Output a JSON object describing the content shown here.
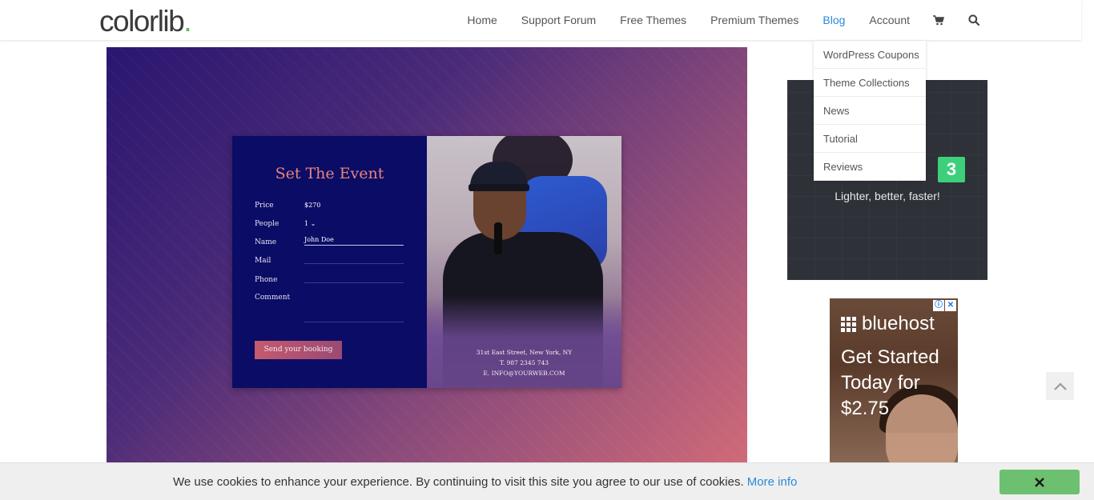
{
  "header": {
    "logo_text": "colorlib",
    "logo_dot": ".",
    "nav": [
      "Home",
      "Support Forum",
      "Free Themes",
      "Premium Themes",
      "Blog",
      "Account"
    ],
    "active_nav": "Blog",
    "icons": [
      "cart-icon",
      "search-icon"
    ]
  },
  "dropdown": {
    "items": [
      "WordPress Coupons",
      "Theme Collections",
      "News",
      "Tutorial",
      "Reviews"
    ]
  },
  "hero_card": {
    "title": "Set The Event",
    "fields": [
      {
        "label": "Price",
        "value": "$270"
      },
      {
        "label": "People",
        "value": "1 ⌄"
      },
      {
        "label": "Name",
        "value": "John Doe"
      },
      {
        "label": "Mail",
        "value": ""
      },
      {
        "label": "Phone",
        "value": ""
      },
      {
        "label": "Comment",
        "value": ""
      }
    ],
    "button_label": "Send your booking",
    "address_lines": [
      "31st East Street, New York, NY",
      "T. 987 2345 743",
      "E. INFO@YOURWEB.COM"
    ]
  },
  "sidebar_banner": {
    "badge_number": "3",
    "tagline": "Lighter, better, faster!"
  },
  "ad": {
    "brand": "bluehost",
    "headline": "Get Started Today for $2.75",
    "info_badge": "ⓘ",
    "close_badge": "✕"
  },
  "cookie_bar": {
    "message": "We use cookies to enhance your experience. By continuing to visit this site you agree to our use of cookies.",
    "link_text": "More info",
    "close_label": "✕"
  },
  "colors": {
    "accent_blue": "#2a8ad8",
    "brand_green": "#5cb85c",
    "event_title": "#e8837a",
    "card_navy": "#0b0c66",
    "cookie_close": "#6cc070"
  }
}
